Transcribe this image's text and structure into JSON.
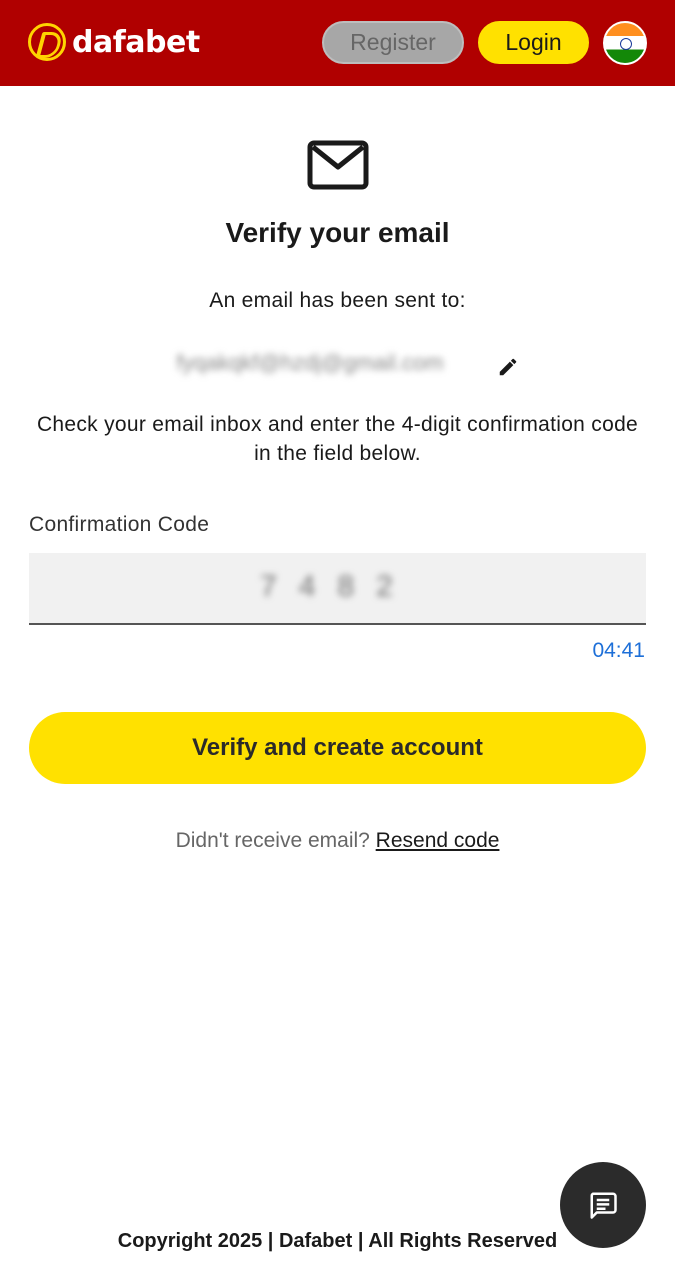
{
  "header": {
    "logo_text": "dafabet",
    "register_label": "Register",
    "login_label": "Login",
    "flag_icon": "india-flag-icon"
  },
  "main": {
    "icon": "mail-icon",
    "title": "Verify your email",
    "sent_to_label": "An email has been sent to:",
    "email": "fyqakqkf@hzdj@gmail.com",
    "edit_icon": "pencil-icon",
    "instructions": "Check your email inbox and enter the 4-digit confirmation code in the field below.",
    "code_label": "Confirmation Code",
    "code_value": "7482",
    "timer": "04:41",
    "verify_button": "Verify and create account",
    "resend_prompt": "Didn't receive email?",
    "resend_link": "Resend code"
  },
  "footer": {
    "chat_icon": "chat-icon",
    "copyright": "Copyright 2025 | Dafabet | All Rights Reserved"
  },
  "colors": {
    "header_bg": "#b00000",
    "accent_yellow": "#ffe100",
    "register_bg": "#a7a7a7",
    "timer_blue": "#1d6fd8",
    "chat_bg": "#2b2b2b"
  }
}
